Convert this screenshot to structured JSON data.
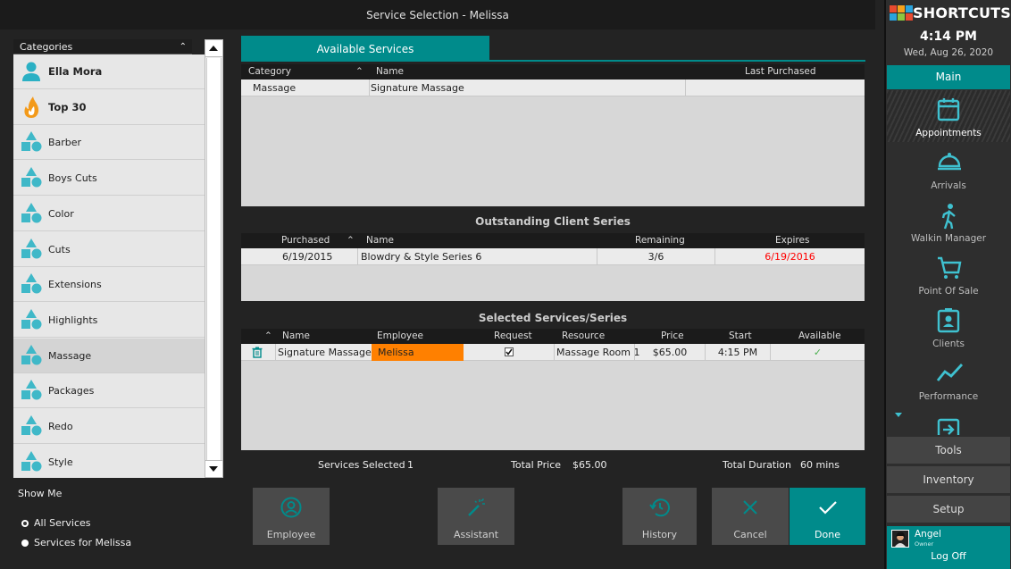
{
  "window": {
    "title": "Service Selection - Melissa"
  },
  "categories": {
    "header": "Categories",
    "items": [
      {
        "label": "Ella Mora",
        "icon": "person-icon",
        "bold": true
      },
      {
        "label": "Top 30",
        "icon": "flame-icon",
        "bold": true
      },
      {
        "label": "Barber",
        "icon": "shapes-icon"
      },
      {
        "label": "Boys Cuts",
        "icon": "shapes-icon"
      },
      {
        "label": "Color",
        "icon": "shapes-icon"
      },
      {
        "label": "Cuts",
        "icon": "shapes-icon"
      },
      {
        "label": "Extensions",
        "icon": "shapes-icon"
      },
      {
        "label": "Highlights",
        "icon": "shapes-icon"
      },
      {
        "label": "Massage",
        "icon": "shapes-icon",
        "selected": true
      },
      {
        "label": "Packages",
        "icon": "shapes-icon"
      },
      {
        "label": "Redo",
        "icon": "shapes-icon"
      },
      {
        "label": "Style",
        "icon": "shapes-icon"
      }
    ]
  },
  "show_me": {
    "label": "Show Me",
    "options": [
      {
        "label": "All Services",
        "checked": true
      },
      {
        "label": "Services for Melissa",
        "checked": false
      }
    ]
  },
  "available": {
    "tab": "Available Services",
    "columns": {
      "category": "Category",
      "name": "Name",
      "last": "Last Purchased"
    },
    "rows": [
      {
        "category": "Massage",
        "name": "Signature Massage",
        "last": ""
      }
    ]
  },
  "series": {
    "title": "Outstanding Client Series",
    "columns": {
      "purchased": "Purchased",
      "name": "Name",
      "remaining": "Remaining",
      "expires": "Expires"
    },
    "rows": [
      {
        "purchased": "6/19/2015",
        "name": "Blowdry & Style Series 6",
        "remaining": "3/6",
        "expires": "6/19/2016"
      }
    ]
  },
  "selected": {
    "title": "Selected Services/Series",
    "columns": {
      "name": "Name",
      "employee": "Employee",
      "request": "Request",
      "resource": "Resource",
      "price": "Price",
      "start": "Start",
      "available": "Available"
    },
    "rows": [
      {
        "name": "Signature Massage",
        "employee": "Melissa",
        "request_checked": true,
        "resource": "Massage Room 1",
        "price": "$65.00",
        "start": "4:15 PM",
        "available": "✓"
      }
    ]
  },
  "summary": {
    "services_label": "Services Selected",
    "services_value": "1",
    "price_label": "Total Price",
    "price_value": "$65.00",
    "duration_label": "Total Duration",
    "duration_value": "60 mins"
  },
  "actions": {
    "employee": "Employee",
    "assistant": "Assistant",
    "history": "History",
    "cancel": "Cancel",
    "done": "Done"
  },
  "sidebar": {
    "brand": "SHORTCUTS",
    "time": "4:14 PM",
    "date": "Wed, Aug 26, 2020",
    "main": "Main",
    "items": [
      {
        "label": "Appointments",
        "icon": "calendar-icon"
      },
      {
        "label": "Arrivals",
        "icon": "bell-icon"
      },
      {
        "label": "Walkin Manager",
        "icon": "walking-person-icon"
      },
      {
        "label": "Point Of Sale",
        "icon": "cart-icon"
      },
      {
        "label": "Clients",
        "icon": "contact-card-icon"
      },
      {
        "label": "Performance",
        "icon": "trend-icon"
      }
    ],
    "tools": "Tools",
    "inventory": "Inventory",
    "setup": "Setup",
    "user": {
      "name": "Angel",
      "role": "Owner",
      "logoff": "Log Off"
    }
  },
  "colors": {
    "accent": "#008b8b",
    "employee_highlight": "#ff8000",
    "expired": "#ff0000",
    "category_icon": "#3fb8c8"
  }
}
